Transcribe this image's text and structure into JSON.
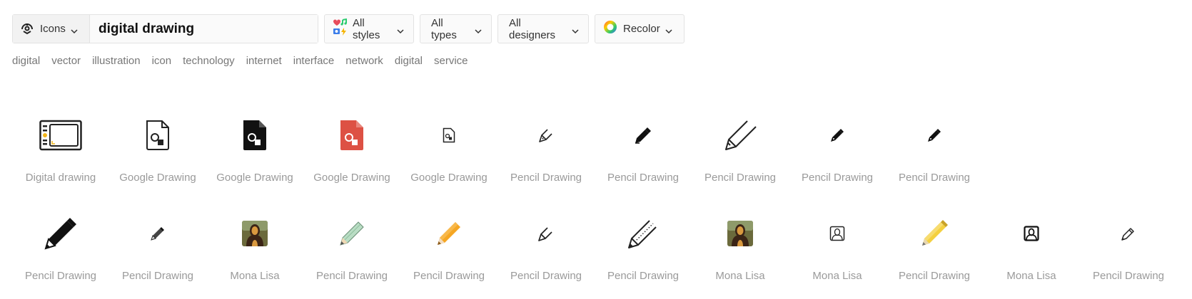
{
  "search": {
    "type_label": "Icons",
    "query": "digital drawing"
  },
  "filters": {
    "styles": "All styles",
    "types": "All types",
    "designers": "All designers",
    "recolor": "Recolor"
  },
  "tags": [
    "digital",
    "vector",
    "illustration",
    "icon",
    "technology",
    "internet",
    "interface",
    "network",
    "digital",
    "service"
  ],
  "results": {
    "row1": [
      {
        "icon": "drawing-tablet-icon",
        "label": "Digital drawing"
      },
      {
        "icon": "google-drawing-outline-icon",
        "label": "Google Drawing"
      },
      {
        "icon": "google-drawing-filled-icon",
        "label": "Google Drawing"
      },
      {
        "icon": "google-drawing-red-icon",
        "label": "Google Drawing"
      },
      {
        "icon": "google-drawing-small-icon",
        "label": "Google Drawing"
      },
      {
        "icon": "pen-outline-icon",
        "label": "Pencil Drawing"
      },
      {
        "icon": "pen-filled-icon",
        "label": "Pencil Drawing"
      },
      {
        "icon": "pen-thin-large-icon",
        "label": "Pencil Drawing"
      },
      {
        "icon": "pen-filled-small-icon",
        "label": "Pencil Drawing"
      },
      {
        "icon": "pen-filled-small-icon",
        "label": "Pencil Drawing"
      }
    ],
    "row2": [
      {
        "icon": "pencil-black-large-icon",
        "label": "Pencil Drawing"
      },
      {
        "icon": "pencil-small-icon",
        "label": "Pencil Drawing"
      },
      {
        "icon": "mona-lisa-color-icon",
        "label": "Mona Lisa"
      },
      {
        "icon": "pencil-green-icon",
        "label": "Pencil Drawing"
      },
      {
        "icon": "pencil-orange-icon",
        "label": "Pencil Drawing"
      },
      {
        "icon": "pen-outline-icon",
        "label": "Pencil Drawing"
      },
      {
        "icon": "pencil-dotted-icon",
        "label": "Pencil Drawing"
      },
      {
        "icon": "mona-lisa-color-icon",
        "label": "Mona Lisa"
      },
      {
        "icon": "mona-lisa-outline-icon",
        "label": "Mona Lisa"
      },
      {
        "icon": "pencil-yellow-icon",
        "label": "Pencil Drawing"
      },
      {
        "icon": "mona-lisa-outline-bold-icon",
        "label": "Mona Lisa"
      },
      {
        "icon": "pencil-outline-icon",
        "label": "Pencil Drawing"
      }
    ]
  },
  "colors": {
    "google_red": "#dd5144",
    "pencil_orange": "#f5a623",
    "pencil_green": "#b9ddc4",
    "pencil_yellow": "#f4d03f",
    "tablet_accent": "#f2b51a"
  }
}
